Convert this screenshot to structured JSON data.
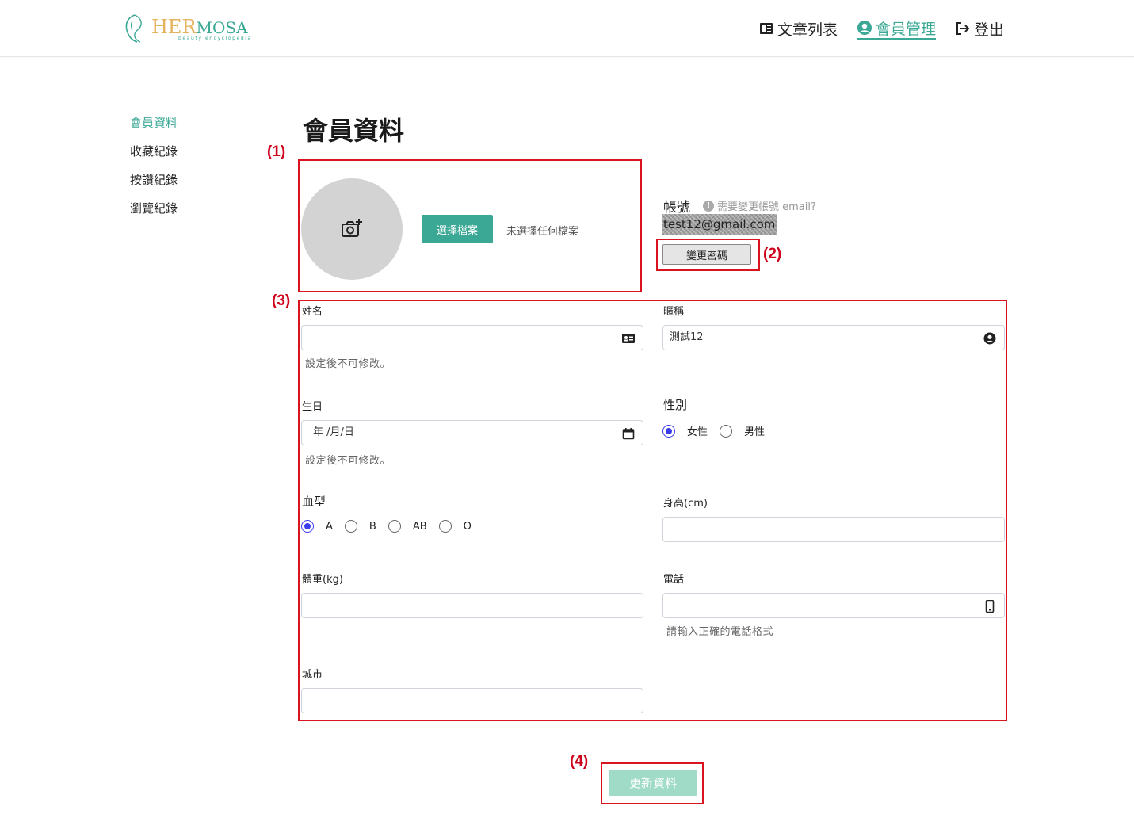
{
  "header": {
    "logo_her": "HER",
    "logo_mosa": "MOSA",
    "logo_sub": "beauty encyclopedia",
    "nav": {
      "articles": "文章列表",
      "member": "會員管理",
      "logout": "登出"
    }
  },
  "sidebar": {
    "items": [
      {
        "label": "會員資料",
        "active": true
      },
      {
        "label": "收藏紀錄",
        "active": false
      },
      {
        "label": "按讚紀錄",
        "active": false
      },
      {
        "label": "瀏覽紀錄",
        "active": false
      }
    ]
  },
  "main": {
    "title": "會員資料",
    "annotations": [
      "(1)",
      "(2)",
      "(3)",
      "(4)"
    ],
    "avatar": {
      "choose_label": "選擇檔案",
      "no_file": "未選擇任何檔案"
    },
    "account": {
      "label": "帳號",
      "help": "需要變更帳號 email?",
      "email": "test12@gmail.com",
      "change_password": "變更密碼"
    },
    "form": {
      "name_label": "姓名",
      "name_value": "",
      "name_hint": "設定後不可修改。",
      "nickname_label": "暱稱",
      "nickname_value": "測試12",
      "birthday_label": "生日",
      "birthday_value": "年 /月/日",
      "birthday_hint": "設定後不可修改。",
      "gender_label": "性別",
      "gender_options": [
        "女性",
        "男性"
      ],
      "gender_selected": "女性",
      "blood_label": "血型",
      "blood_options": [
        "A",
        "B",
        "AB",
        "O"
      ],
      "blood_selected": "A",
      "height_label": "身高(cm)",
      "weight_label": "體重(kg)",
      "phone_label": "電話",
      "phone_hint": "請輸入正確的電話格式",
      "city_label": "城市"
    },
    "update_button": "更新資料"
  },
  "colors": {
    "accent": "#3aa894",
    "accent_light": "#9fdbc7",
    "annotation_red": "#d9141e",
    "radio_blue": "#3b3bf0"
  }
}
